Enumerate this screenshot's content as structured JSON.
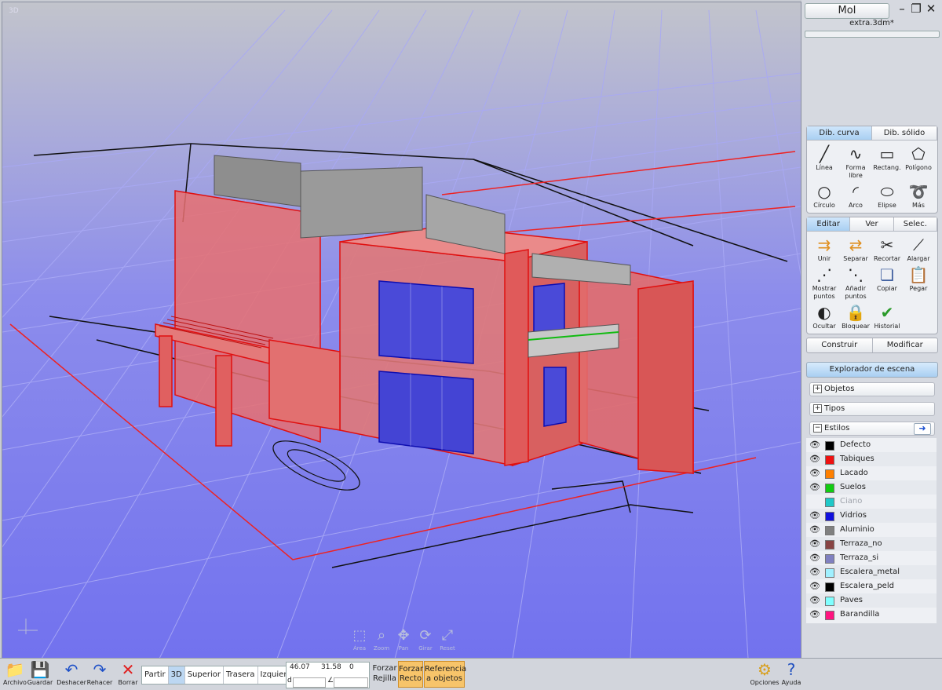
{
  "viewport": {
    "label": "3D",
    "nav": [
      "Área",
      "Zoom",
      "Pan",
      "Girar",
      "Reset"
    ]
  },
  "panel": {
    "app_name": "MoI",
    "file_name": "extra.3dm*",
    "draw_tabs": [
      "Dib. curva",
      "Dib. sólido"
    ],
    "draw_tools": [
      "Línea",
      "Forma libre",
      "Rectang.",
      "Polígono",
      "Círculo",
      "Arco",
      "Elipse",
      "Más"
    ],
    "edit_tabs": [
      "Editar",
      "Ver",
      "Selec."
    ],
    "edit_tools": [
      "Unir",
      "Separar",
      "Recortar",
      "Alargar",
      "Mostrar puntos",
      "Añadir puntos",
      "Copiar",
      "Pegar",
      "Ocultar",
      "Bloquear",
      "Historial"
    ],
    "construct_label": "Construir",
    "modify_label": "Modificar",
    "scene_explorer": "Explorador de escena",
    "sections": [
      "Objetos",
      "Tipos",
      "Estilos"
    ],
    "styles": [
      {
        "name": "Defecto",
        "color": "#000000"
      },
      {
        "name": "Tabiques",
        "color": "#ee1111"
      },
      {
        "name": "Lacado",
        "color": "#ff8000"
      },
      {
        "name": "Suelos",
        "color": "#11cc11"
      },
      {
        "name": "Ciano",
        "color": "#20c8c8"
      },
      {
        "name": "Vidrios",
        "color": "#1010dd"
      },
      {
        "name": "Aluminio",
        "color": "#808080"
      },
      {
        "name": "Terraza_no",
        "color": "#884444"
      },
      {
        "name": "Terraza_si",
        "color": "#8080c0"
      },
      {
        "name": "Escalera_metal",
        "color": "#a0f0ff"
      },
      {
        "name": "Escalera_peld",
        "color": "#000000"
      },
      {
        "name": "Paves",
        "color": "#80ffff"
      },
      {
        "name": "Barandilla",
        "color": "#ff1480"
      }
    ]
  },
  "toolbar": {
    "archivo": "Archivo",
    "guardar": "Guardar",
    "deshacer": "Deshacer",
    "rehacer": "Rehacer",
    "borrar": "Borrar",
    "views": [
      "Partir",
      "3D",
      "Superior",
      "Trasera",
      "Izquierda"
    ],
    "coords": {
      "x": "46.07",
      "y": "31.58",
      "z": "0",
      "d_label": "d",
      "angle_label": "∠"
    },
    "forzar_rejilla": [
      "Forzar",
      "Rejilla"
    ],
    "forzar_recto": [
      "Forzar",
      "Recto"
    ],
    "referencia": [
      "Referencia",
      "a objetos"
    ],
    "opciones": "Opciones",
    "ayuda": "Ayuda"
  }
}
